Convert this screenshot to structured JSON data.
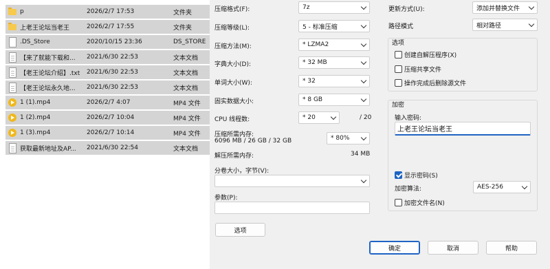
{
  "file_list": {
    "rows": [
      {
        "icon": "folder-icon",
        "name": "p",
        "date": "2026/2/7 17:53",
        "type": "文件夹"
      },
      {
        "icon": "folder-icon",
        "name": "上老王论坛当老王",
        "date": "2026/2/7 17:55",
        "type": "文件夹"
      },
      {
        "icon": "file-icon",
        "name": ".DS_Store",
        "date": "2020/10/15 23:36",
        "type": "DS_STORE"
      },
      {
        "icon": "text-file-icon",
        "name": "【来了就能下载和...",
        "date": "2021/6/30 22:53",
        "type": "文本文档"
      },
      {
        "icon": "text-file-icon",
        "name": "【老王论坛介绍】.txt",
        "date": "2021/6/30 22:53",
        "type": "文本文档"
      },
      {
        "icon": "text-file-icon",
        "name": "【老王论坛永久地...",
        "date": "2021/6/30 22:53",
        "type": "文本文档"
      },
      {
        "icon": "mp4-icon",
        "name": "1 (1).mp4",
        "date": "2026/2/7 4:07",
        "type": "MP4 文件"
      },
      {
        "icon": "mp4-icon",
        "name": "1 (2).mp4",
        "date": "2026/2/7 10:04",
        "type": "MP4 文件"
      },
      {
        "icon": "mp4-icon",
        "name": "1 (3).mp4",
        "date": "2026/2/7 10:14",
        "type": "MP4 文件"
      },
      {
        "icon": "text-file-icon",
        "name": "获取最新地址及AP...",
        "date": "2021/6/30 22:54",
        "type": "文本文档"
      }
    ]
  },
  "left": {
    "format_label": "压缩格式(F):",
    "format_value": "7z",
    "level_label": "压缩等级(L):",
    "level_value": "5 - 标准压缩",
    "method_label": "压缩方法(M):",
    "method_value": "* LZMA2",
    "dict_label": "字典大小(D):",
    "dict_value": "* 32 MB",
    "word_label": "单词大小(W):",
    "word_value": "* 32",
    "solid_label": "固实数据大小:",
    "solid_value": "* 8 GB",
    "cpu_label": "CPU 线程数:",
    "cpu_value": "* 20",
    "cpu_max": "/ 20",
    "mem_comp_label": "压缩所需内存:",
    "mem_comp_detail": "6096 MB / 26 GB / 32 GB",
    "mem_comp_value": "* 80%",
    "mem_decomp_label": "解压所需内存:",
    "mem_decomp_value": "34 MB",
    "volume_label": "分卷大小，字节(V):",
    "volume_value": "",
    "params_label": "参数(P):",
    "params_value": "",
    "options_button": "选项"
  },
  "right": {
    "update_label": "更新方式(U):",
    "update_value": "添加并替换文件",
    "path_label": "路径模式",
    "path_value": "相对路径",
    "options_group": "选项",
    "opt_sfx": "创建自解压程序(X)",
    "opt_shared": "压缩共享文件",
    "opt_delete": "操作完成后删除源文件",
    "encrypt_group": "加密",
    "password_label": "输入密码:",
    "password_value": "上老王论坛当老王",
    "show_password": "显示密码(S)",
    "algo_label": "加密算法:",
    "algo_value": "AES-256",
    "encrypt_names": "加密文件名(N)"
  },
  "buttons": {
    "ok": "确定",
    "cancel": "取消",
    "help": "帮助"
  }
}
